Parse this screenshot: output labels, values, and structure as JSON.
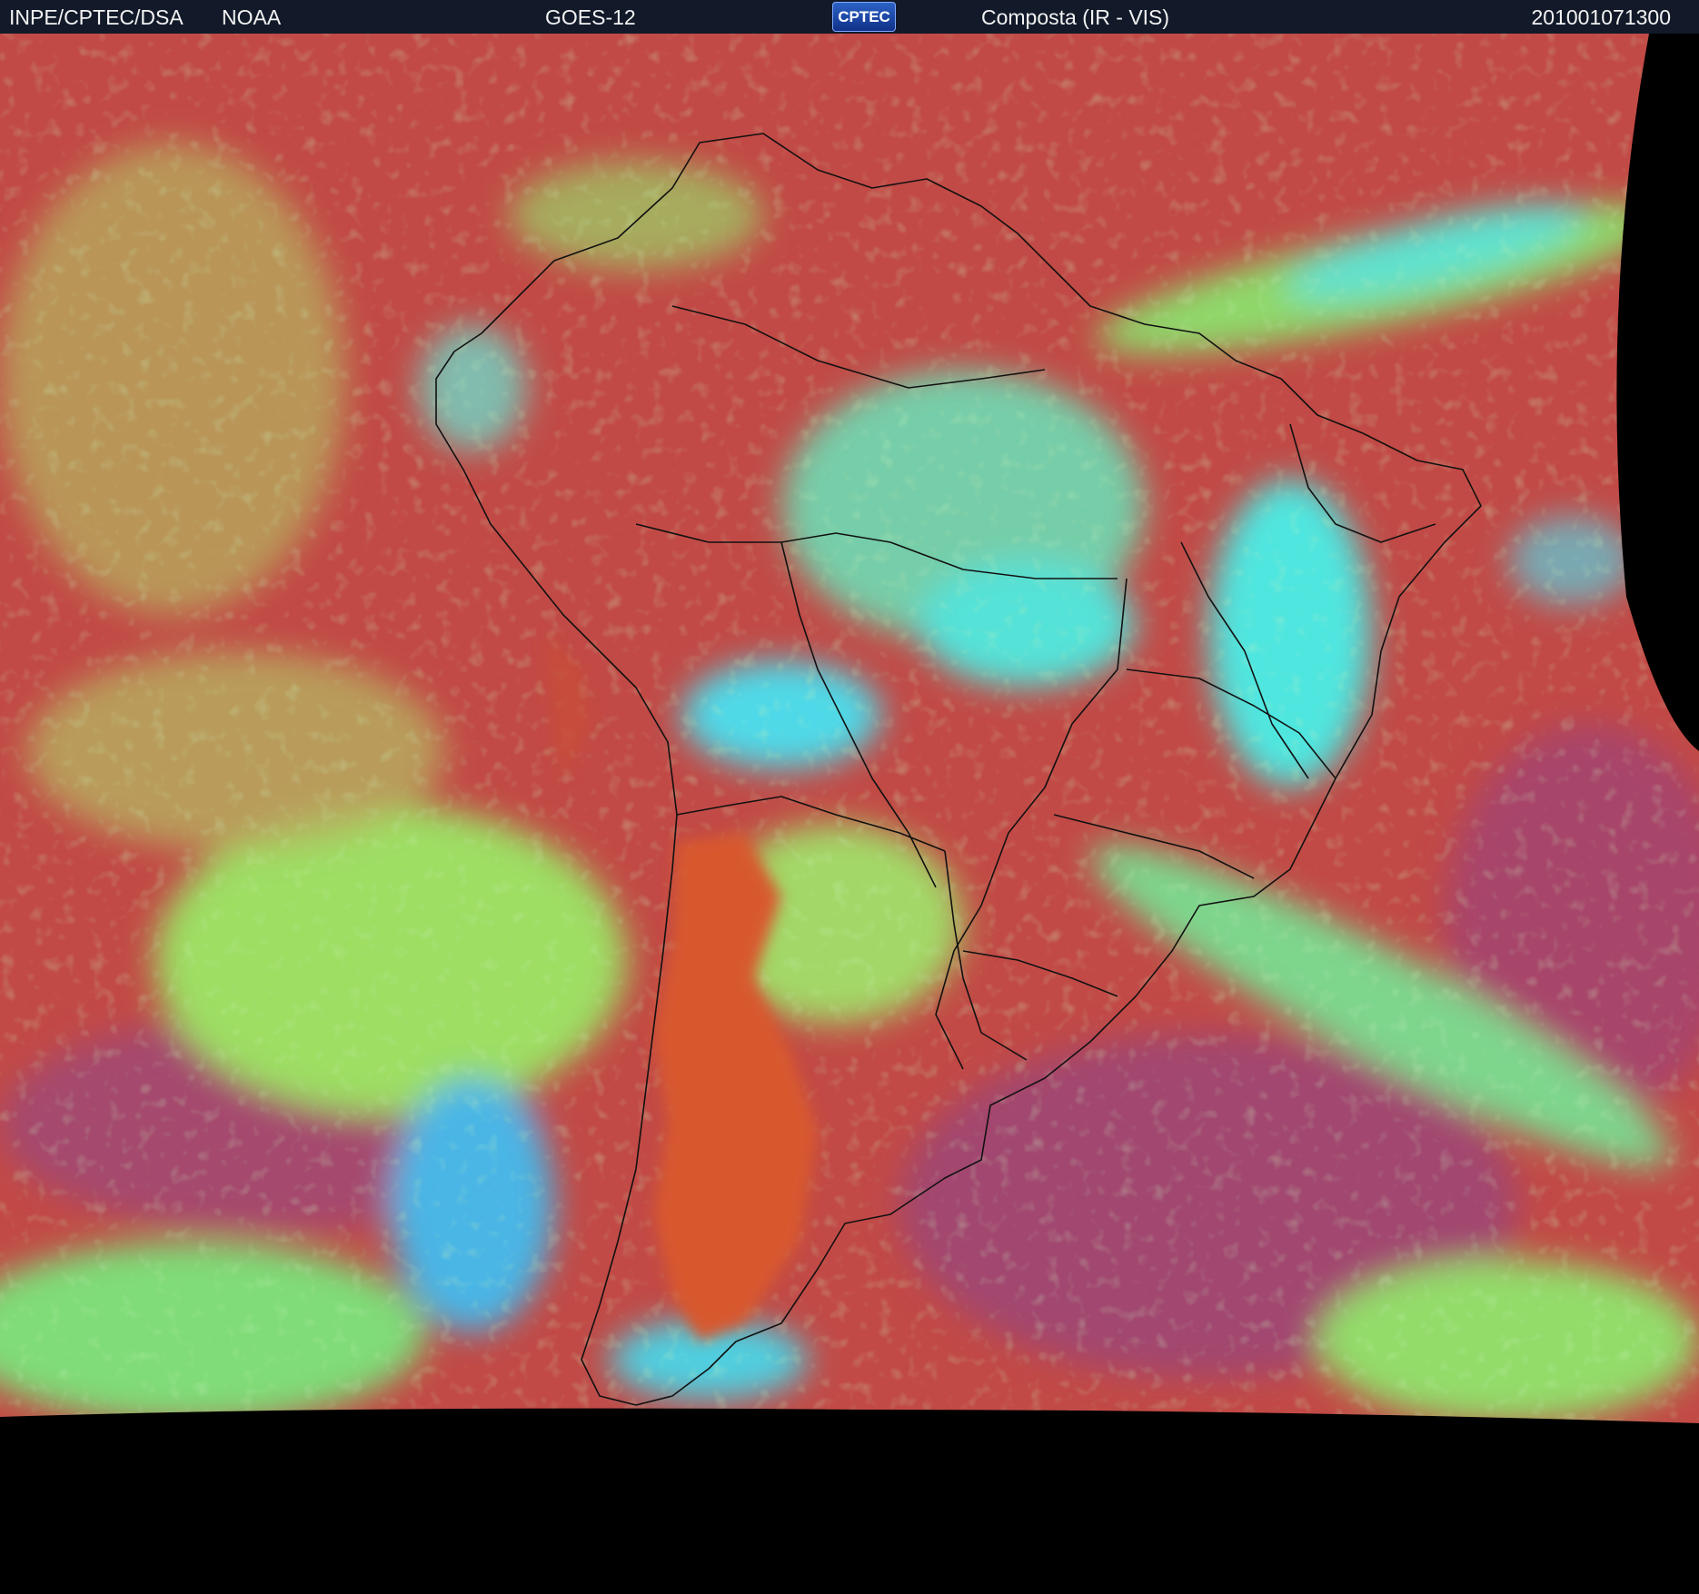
{
  "header": {
    "organization": "INPE/CPTEC/DSA",
    "agency": "NOAA",
    "satellite": "GOES-12",
    "product": "Composta (IR - VIS)",
    "timestamp": "201001071300"
  },
  "logo": {
    "text": "CPTEC"
  },
  "image": {
    "subject": "satellite-composite-south-america",
    "colors": {
      "ocean_warm": "#c24a46",
      "ocean_dark": "#a24770",
      "land_dry": "#d8582e",
      "low_cloud": "#9dde63",
      "high_cloud": "#4fe6e0",
      "outside_disk": "#000000"
    }
  }
}
